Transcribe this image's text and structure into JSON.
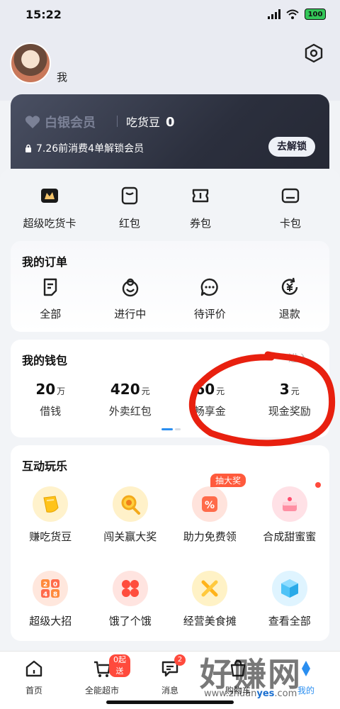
{
  "status": {
    "time": "15:22",
    "battery": "100"
  },
  "profile": {
    "username": "我"
  },
  "member_card": {
    "brand": "白银会员",
    "beans_label": "吃货豆",
    "beans_value": "0",
    "tip": "7.26前消费4单解锁会员",
    "unlock_button": "去解锁"
  },
  "quick_actions": [
    {
      "label": "超级吃货卡",
      "icon": "super-card-icon"
    },
    {
      "label": "红包",
      "icon": "red-packet-icon"
    },
    {
      "label": "券包",
      "icon": "coupon-icon"
    },
    {
      "label": "卡包",
      "icon": "card-wallet-icon"
    }
  ],
  "orders": {
    "title": "我的订单",
    "items": [
      {
        "label": "全部",
        "icon": "all-orders-icon"
      },
      {
        "label": "进行中",
        "icon": "in-progress-icon"
      },
      {
        "label": "待评价",
        "icon": "review-icon"
      },
      {
        "label": "退款",
        "icon": "refund-icon"
      }
    ]
  },
  "wallet": {
    "title": "我的钱包",
    "enter_link": "进入",
    "items": [
      {
        "value": "20",
        "unit": "万",
        "label": "借钱"
      },
      {
        "value": "420",
        "unit": "元",
        "label": "外卖红包"
      },
      {
        "value": "60",
        "unit": "元",
        "label": "畅享金"
      },
      {
        "value": "3",
        "unit": "元",
        "label": "现金奖励"
      }
    ]
  },
  "games": {
    "title": "互动玩乐",
    "items": [
      {
        "label": "赚吃货豆",
        "icon": "bean-icon"
      },
      {
        "label": "闯关赢大奖",
        "icon": "magnifier-icon"
      },
      {
        "label": "助力免费领",
        "icon": "ticket-icon",
        "badge": "抽大奖"
      },
      {
        "label": "合成甜蜜蜜",
        "icon": "cake-icon",
        "dot": true
      },
      {
        "label": "超级大招",
        "icon": "2048-icon"
      },
      {
        "label": "饿了个饿",
        "icon": "heart-tiles-icon"
      },
      {
        "label": "经营美食摊",
        "icon": "crossed-tools-icon"
      },
      {
        "label": "查看全部",
        "icon": "cube-icon"
      }
    ]
  },
  "tabbar": [
    {
      "label": "首页",
      "icon": "home-icon"
    },
    {
      "label": "全能超市",
      "icon": "supermarket-icon",
      "badge": "0起送"
    },
    {
      "label": "消息",
      "icon": "message-icon",
      "badge": "2"
    },
    {
      "label": "购物车",
      "icon": "cart-icon"
    },
    {
      "label": "我的",
      "icon": "profile-icon"
    }
  ],
  "watermark": {
    "title": "好赚网",
    "url_prefix": "www.zhuan",
    "url_highlight": "yes",
    "url_suffix": ".com"
  },
  "colors": {
    "accent": "#ff4a3c",
    "card_dark": "#2b2f3d",
    "annotation_red": "#e8200f"
  }
}
